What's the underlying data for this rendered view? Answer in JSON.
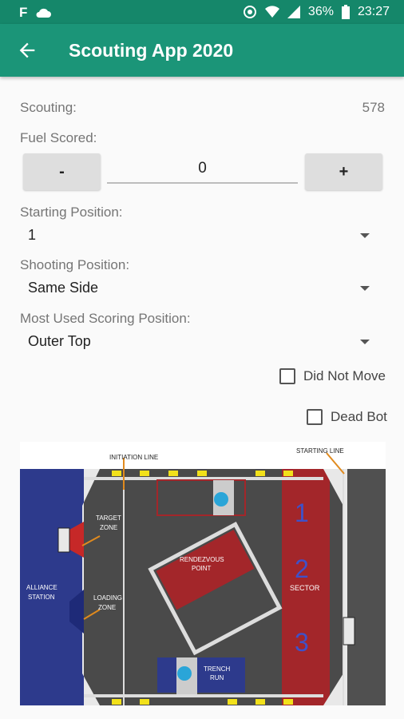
{
  "status": {
    "battery": "36%",
    "time": "23:27"
  },
  "appbar": {
    "title": "Scouting App 2020"
  },
  "scouting": {
    "label": "Scouting:",
    "team": "578"
  },
  "fuel": {
    "label": "Fuel Scored:",
    "minus": "-",
    "plus": "+",
    "value": "0"
  },
  "starting": {
    "label": "Starting Position:",
    "value": "1"
  },
  "shooting": {
    "label": "Shooting Position:",
    "value": "Same Side"
  },
  "most_used": {
    "label": "Most Used Scoring Position:",
    "value": "Outer Top"
  },
  "checks": {
    "did_not_move": "Did Not Move",
    "dead_bot": "Dead Bot"
  },
  "field": {
    "initiation_line": "INITIATION LINE",
    "starting_line": "STARTING LINE",
    "target_zone_1": "TARGET",
    "target_zone_2": "ZONE",
    "loading_zone_1": "LOADING",
    "loading_zone_2": "ZONE",
    "alliance_station_1": "ALLIANCE",
    "alliance_station_2": "STATION",
    "rendezvous_1": "RENDEZVOUS",
    "rendezvous_2": "POINT",
    "sector": "SECTOR",
    "trench_1": "TRENCH",
    "trench_2": "RUN",
    "num_1": "1",
    "num_2": "2",
    "num_3": "3"
  }
}
